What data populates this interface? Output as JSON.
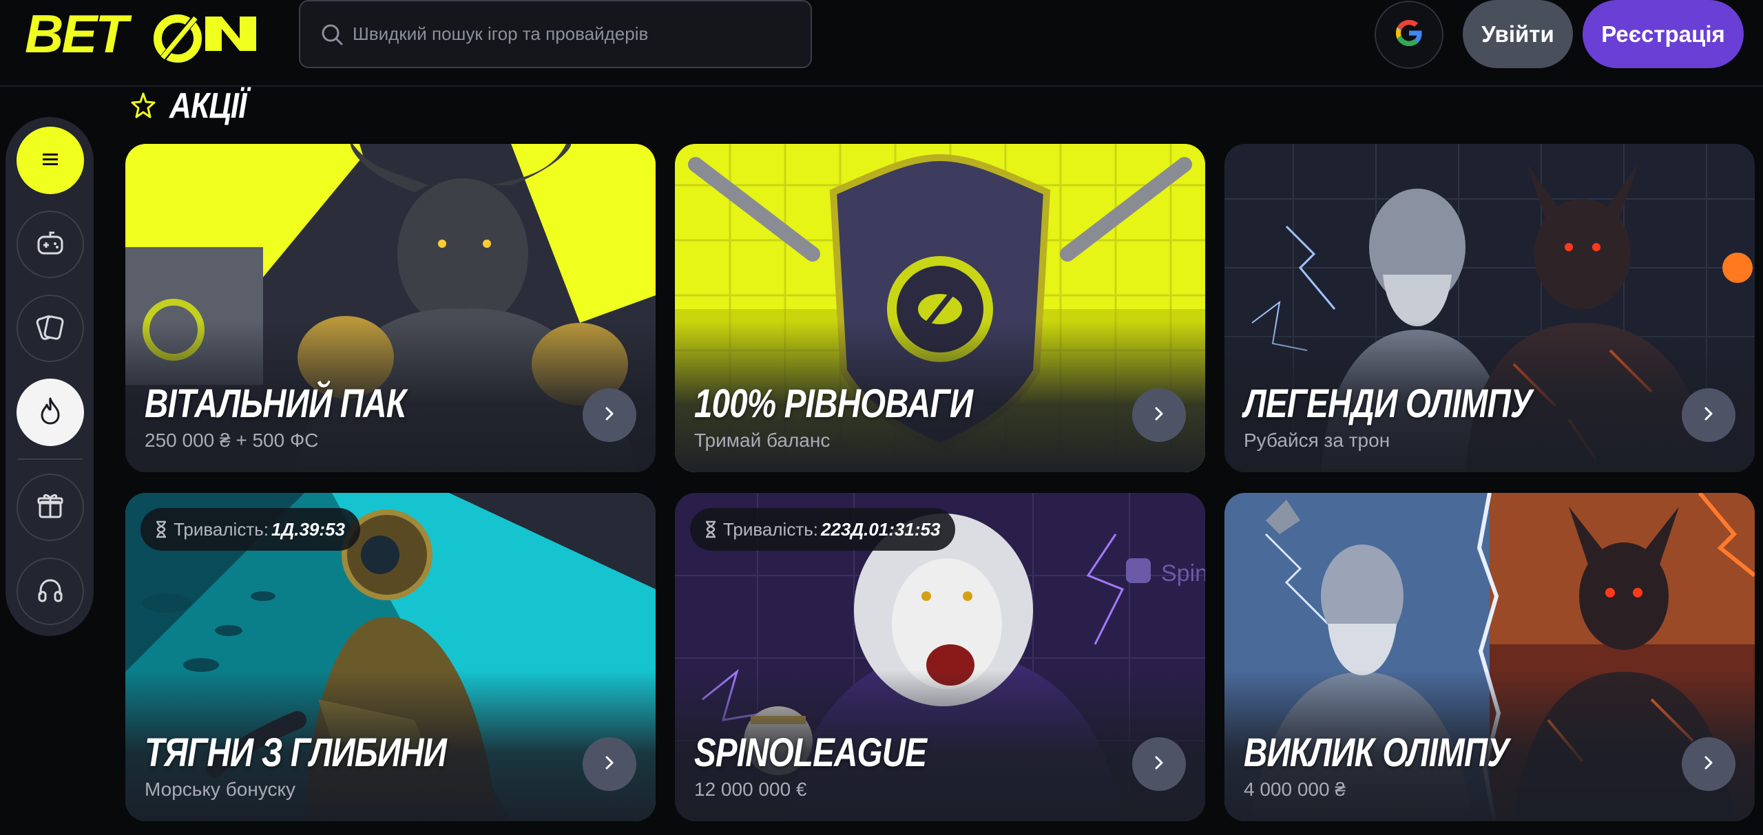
{
  "header": {
    "logo_text": "BETON",
    "search": {
      "placeholder": "Швидкий пошук ігор та провайдерів"
    },
    "login_label": "Увійти",
    "register_label": "Реєстрація"
  },
  "sidebar": {
    "items": [
      {
        "icon": "menu-icon"
      },
      {
        "icon": "gamepad-icon"
      },
      {
        "icon": "cards-icon"
      },
      {
        "icon": "flame-icon"
      },
      {
        "icon": "gift-icon"
      },
      {
        "icon": "headphones-icon"
      }
    ]
  },
  "section": {
    "title": "АКЦІЇ"
  },
  "promos": [
    {
      "title": "ВІТАЛЬНИЙ ПАК",
      "subtitle": "250 000 ₴ + 500 ФС"
    },
    {
      "title": "100% РІВНОВАГИ",
      "subtitle": "Тримай баланс"
    },
    {
      "title": "ЛЕГЕНДИ ОЛІМПУ",
      "subtitle": "Рубайся за трон"
    },
    {
      "title": "ТЯГНИ З ГЛИБИНИ",
      "subtitle": "Морську бонуску",
      "timer_label": "Тривалість:",
      "timer_value": "1Д.39:53"
    },
    {
      "title": "SPINOLEAGUE",
      "subtitle": "12 000 000 €",
      "timer_label": "Тривалість:",
      "timer_value": "223Д.01:31:53",
      "watermark": "Spin"
    },
    {
      "title": "ВИКЛИК ОЛІМПУ",
      "subtitle": "4 000 000 ₴"
    }
  ],
  "colors": {
    "accent": "#f0ff1e",
    "primary": "#6a3fd6",
    "background": "#08090b",
    "card": "#1b1e27"
  }
}
